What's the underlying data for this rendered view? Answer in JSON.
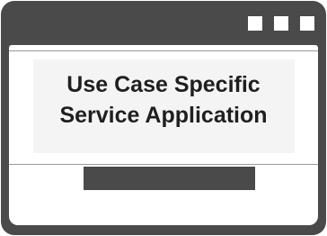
{
  "window": {
    "frame_color": "#4a4a4a",
    "controls": [
      "square-icon",
      "square-icon",
      "square-icon"
    ]
  },
  "heading": {
    "line1": "Use Case Specific",
    "line2": "Service Application"
  }
}
